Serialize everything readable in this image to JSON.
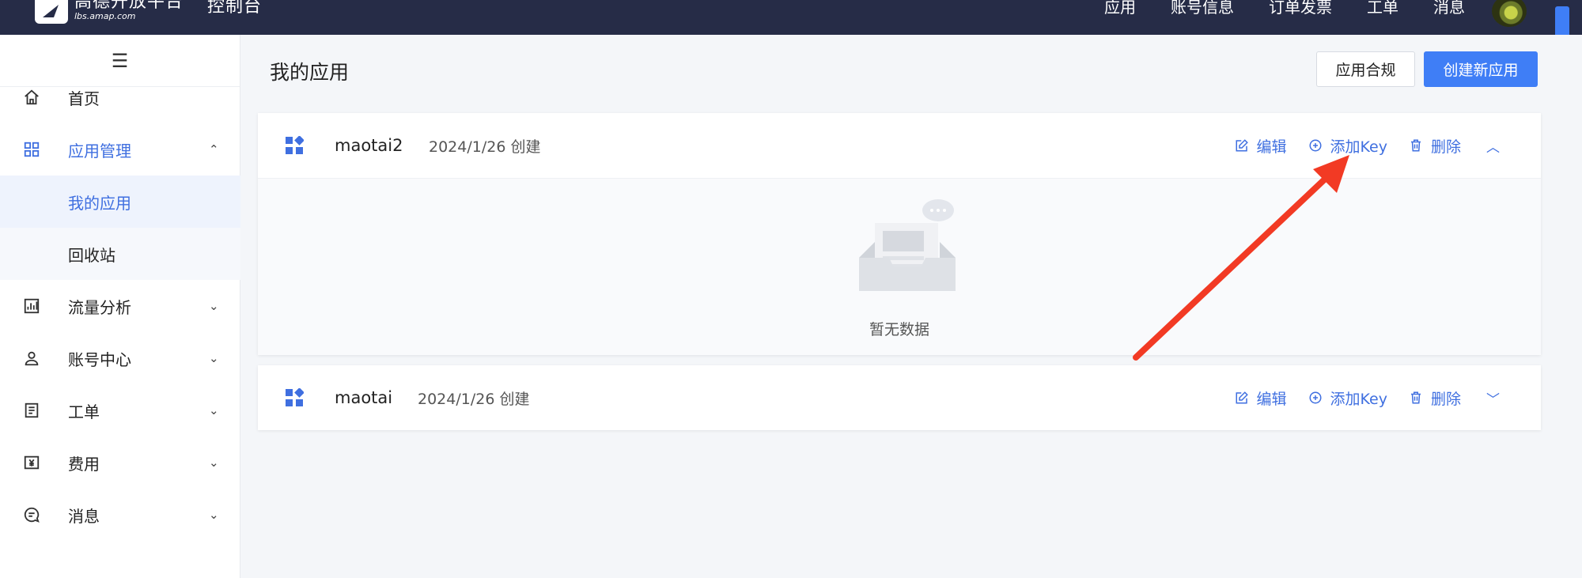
{
  "topbar": {
    "logo_title": "高德开放平台",
    "logo_sub": "lbs.amap.com",
    "console": "控制台",
    "nav": [
      "应用",
      "账号信息",
      "订单发票",
      "工单",
      "消息"
    ]
  },
  "sidebar": {
    "toggle": "☰",
    "items": [
      {
        "label": "首页",
        "icon": "home-icon"
      },
      {
        "label": "应用管理",
        "icon": "grid-icon",
        "chevron": "⌃"
      },
      {
        "label": "我的应用"
      },
      {
        "label": "回收站"
      },
      {
        "label": "流量分析",
        "icon": "chart-icon",
        "chevron": "⌄"
      },
      {
        "label": "账号中心",
        "icon": "user-icon",
        "chevron": "⌄"
      },
      {
        "label": "工单",
        "icon": "clipboard-icon",
        "chevron": "⌄"
      },
      {
        "label": "费用",
        "icon": "yen-icon",
        "chevron": "⌄"
      },
      {
        "label": "消息",
        "icon": "message-icon",
        "chevron": "⌄"
      }
    ]
  },
  "main": {
    "title": "我的应用",
    "compliance_btn": "应用合规",
    "create_btn": "创建新应用",
    "apps": [
      {
        "name": "maotai2",
        "date": "2024/1/26 创建",
        "expanded": true
      },
      {
        "name": "maotai",
        "date": "2024/1/26 创建",
        "expanded": false
      }
    ],
    "actions": {
      "edit": "编辑",
      "add_key": "添加Key",
      "delete": "删除"
    },
    "empty_text": "暂无数据"
  },
  "colors": {
    "accent": "#3f6fe0",
    "primary_btn": "#3f7ef6",
    "topbar": "#262c47",
    "annotation_arrow": "#f23a24"
  }
}
